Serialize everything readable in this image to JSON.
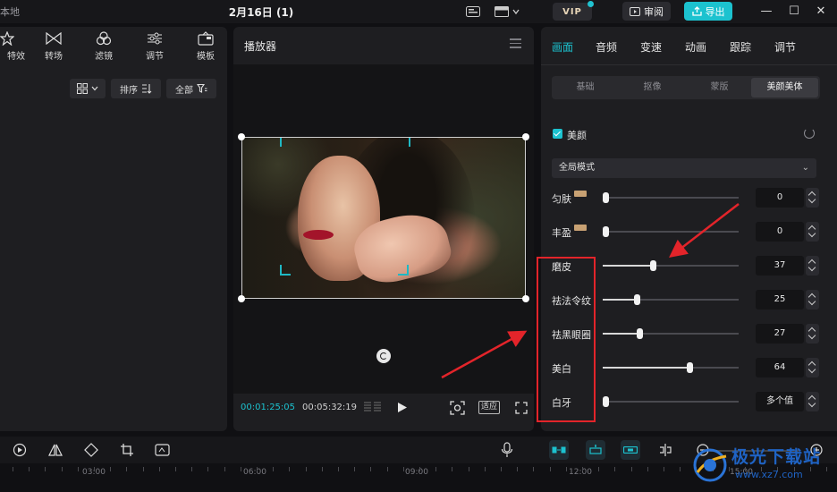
{
  "titlebar": {
    "local_label": "本地",
    "project_title": "2月16日 (1)",
    "vip_label": "VIP",
    "review_label": "审阅",
    "export_label": "导出",
    "minimize": "—",
    "maximize": "☐",
    "close": "✕"
  },
  "media_panel": {
    "tabs": [
      {
        "label": "特效",
        "icon": "effects-icon"
      },
      {
        "label": "转场",
        "icon": "transition-icon"
      },
      {
        "label": "滤镜",
        "icon": "filter-icon"
      },
      {
        "label": "调节",
        "icon": "adjust-icon"
      },
      {
        "label": "模板",
        "icon": "template-icon"
      }
    ],
    "sort_label": "排序",
    "all_label": "全部"
  },
  "player": {
    "title": "播放器",
    "current_time": "00:01:25:05",
    "total_time": "00:05:32:19",
    "fit_label": "适应"
  },
  "properties": {
    "tabs": [
      "画面",
      "音频",
      "变速",
      "动画",
      "跟踪",
      "调节"
    ],
    "active_tab": "画面",
    "subtabs": [
      "基础",
      "抠像",
      "蒙版",
      "美颜美体"
    ],
    "active_subtab": "美颜美体",
    "beauty_checkbox_label": "美颜",
    "mode_select": "全局模式",
    "rows": [
      {
        "label": "匀肤",
        "vip": true,
        "value": "0",
        "fraction": 0.0
      },
      {
        "label": "丰盈",
        "vip": true,
        "value": "0",
        "fraction": 0.0
      },
      {
        "label": "磨皮",
        "vip": false,
        "value": "37",
        "fraction": 0.37
      },
      {
        "label": "祛法令纹",
        "vip": false,
        "value": "25",
        "fraction": 0.25
      },
      {
        "label": "祛黑眼圈",
        "vip": false,
        "value": "27",
        "fraction": 0.27
      },
      {
        "label": "美白",
        "vip": false,
        "value": "64",
        "fraction": 0.64
      },
      {
        "label": "白牙",
        "vip": false,
        "value": "多个值",
        "fraction": 0.0
      }
    ]
  },
  "timeline": {
    "tick_labels": [
      "03:00",
      "06:00",
      "09:00",
      "12:00",
      "15:00"
    ]
  },
  "watermark": {
    "brand_text": "极光下载站",
    "url": "www.xz7.com"
  },
  "colors": {
    "accent": "#1cc2cf",
    "annotation_red": "#e3242a",
    "panel_bg": "#1e1e21"
  }
}
